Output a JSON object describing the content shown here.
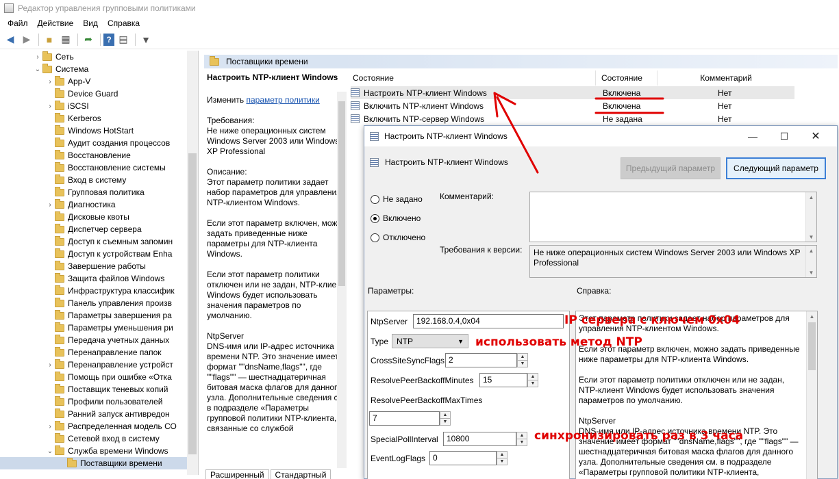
{
  "window": {
    "title": "Редактор управления групповыми политиками"
  },
  "menu": [
    "Файл",
    "Действие",
    "Вид",
    "Справка"
  ],
  "tree": {
    "items": [
      {
        "label": "Сеть",
        "level": 1,
        "expander": "›"
      },
      {
        "label": "Система",
        "level": 1,
        "expander": "⌄"
      },
      {
        "label": "App-V",
        "level": 2,
        "expander": "›"
      },
      {
        "label": "Device Guard",
        "level": 2,
        "expander": ""
      },
      {
        "label": "iSCSI",
        "level": 2,
        "expander": "›"
      },
      {
        "label": "Kerberos",
        "level": 2,
        "expander": ""
      },
      {
        "label": "Windows HotStart",
        "level": 2,
        "expander": ""
      },
      {
        "label": "Аудит создания процессов",
        "level": 2,
        "expander": ""
      },
      {
        "label": "Восстановление",
        "level": 2,
        "expander": ""
      },
      {
        "label": "Восстановление системы",
        "level": 2,
        "expander": ""
      },
      {
        "label": "Вход в систему",
        "level": 2,
        "expander": ""
      },
      {
        "label": "Групповая политика",
        "level": 2,
        "expander": ""
      },
      {
        "label": "Диагностика",
        "level": 2,
        "expander": "›"
      },
      {
        "label": "Дисковые квоты",
        "level": 2,
        "expander": ""
      },
      {
        "label": "Диспетчер сервера",
        "level": 2,
        "expander": ""
      },
      {
        "label": "Доступ к съемным запомин",
        "level": 2,
        "expander": ""
      },
      {
        "label": "Доступ к устройствам Enha",
        "level": 2,
        "expander": ""
      },
      {
        "label": "Завершение работы",
        "level": 2,
        "expander": ""
      },
      {
        "label": "Защита файлов Windows",
        "level": 2,
        "expander": ""
      },
      {
        "label": "Инфраструктура классифик",
        "level": 2,
        "expander": ""
      },
      {
        "label": "Панель управления произв",
        "level": 2,
        "expander": ""
      },
      {
        "label": "Параметры завершения ра",
        "level": 2,
        "expander": ""
      },
      {
        "label": "Параметры уменьшения ри",
        "level": 2,
        "expander": ""
      },
      {
        "label": "Передача учетных данных",
        "level": 2,
        "expander": ""
      },
      {
        "label": "Перенаправление папок",
        "level": 2,
        "expander": ""
      },
      {
        "label": "Перенаправление устройст",
        "level": 2,
        "expander": "›"
      },
      {
        "label": "Помощь при ошибке «Отка",
        "level": 2,
        "expander": ""
      },
      {
        "label": "Поставщик теневых копий",
        "level": 2,
        "expander": ""
      },
      {
        "label": "Профили пользователей",
        "level": 2,
        "expander": ""
      },
      {
        "label": "Ранний запуск антивредон",
        "level": 2,
        "expander": ""
      },
      {
        "label": "Распределенная модель СО",
        "level": 2,
        "expander": "›"
      },
      {
        "label": "Сетевой вход в систему",
        "level": 2,
        "expander": ""
      },
      {
        "label": "Служба времени Windows",
        "level": 2,
        "expander": "⌄"
      },
      {
        "label": "Поставщики времени",
        "level": 3,
        "expander": "",
        "selected": true
      }
    ]
  },
  "breadcrumb": "Поставщики времени",
  "description": {
    "title": "Настроить NTP-клиент Windows",
    "edit_prefix": "Изменить ",
    "edit_link": "параметр политики",
    "requirements": "Требования:\nНе ниже операционных систем Windows Server 2003 или Windows XP Professional",
    "desc": "Описание:\nЭтот параметр политики задает набор параметров для управления NTP-клиентом Windows.",
    "p_enabled": "Если этот параметр включен, можно задать приведенные ниже параметры для NTP-клиента Windows.",
    "p_disabled": "Если этот параметр политики отключен или не задан, NTP-клиент Windows будет использовать значения параметров по умолчанию.",
    "p_ntp": "NtpServer\nDNS-имя или IP-адрес источника времени NTP. Это значение имеет формат \"\"dnsName,flags\"\", где \"\"flags\"\" — шестнадцатеричная битовая маска флагов для данного узла. Дополнительные сведения см. в подразделе «Параметры групповой политики NTP-клиента, связанные со службой"
  },
  "tabs": [
    "Расширенный",
    "Стандартный"
  ],
  "list": {
    "columns": [
      "Состояние",
      "Состояние",
      "Комментарий"
    ],
    "rows": [
      {
        "name": "Настроить NTP-клиент Windows",
        "state": "Включена",
        "comment": "Нет"
      },
      {
        "name": "Включить NTP-клиент Windows",
        "state": "Включена",
        "comment": "Нет"
      },
      {
        "name": "Включить NTP-сервер Windows",
        "state": "Не задана",
        "comment": "Нет"
      }
    ]
  },
  "dialog": {
    "title": "Настроить NTP-клиент Windows",
    "heading": "Настроить NTP-клиент Windows",
    "prev_button": "Предыдущий параметр",
    "next_button": "Следующий параметр",
    "radio_not_set": "Не задано",
    "radio_enabled": "Включено",
    "radio_disabled": "Отключено",
    "comment_label": "Комментарий:",
    "comment_value": "",
    "version_label": "Требования к версии:",
    "version_value": "Не ниже операционных систем Windows Server 2003 или Windows XP Professional",
    "params_label": "Параметры:",
    "help_label": "Справка:",
    "params": {
      "ntp_server_label": "NtpServer",
      "ntp_server_value": "192.168.0.4,0x04",
      "type_label": "Type",
      "type_value": "NTP",
      "cross_label": "CrossSiteSyncFlags",
      "cross_value": "2",
      "resolve_min_label": "ResolvePeerBackoffMinutes",
      "resolve_min_value": "15",
      "resolve_max_label": "ResolvePeerBackoffMaxTimes",
      "resolve_max_value": "7",
      "special_label": "SpecialPollInterval",
      "special_value": "10800",
      "event_label": "EventLogFlags",
      "event_value": "0"
    },
    "help": {
      "p1": "Этот параметр политики задает набор параметров для управления NTP-клиентом Windows.",
      "p2": "Если этот параметр включен, можно задать приведенные ниже параметры для NTP-клиента Windows.",
      "p3": "Если этот параметр политики отключен или не задан, NTP-клиент Windows будет использовать значения параметров по умолчанию.",
      "p4": "NtpServer\nDNS-имя или IP-адрес источника времени NTP. Это значение имеет формат \"\"dnsName,flags\"\", где \"\"flags\"\" — шестнадцатеричная битовая маска флагов для данного узла. Дополнительные сведения см. в подразделе «Параметры групповой политики NTP-клиента, связанные со службой"
    }
  },
  "annotations": {
    "ip": "IP сервера с ключем 0x04",
    "method": "использовать метод NTP",
    "sync": "синхронизировать раз в 3 часа",
    "color": "#e00000"
  }
}
